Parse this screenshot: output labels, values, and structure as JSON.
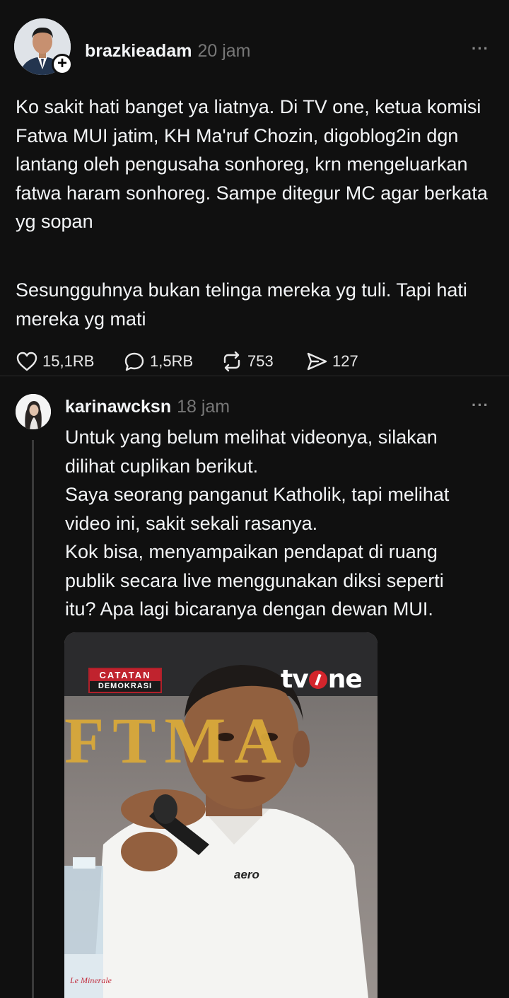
{
  "post": {
    "username": "brazkieadam",
    "time": "20 jam",
    "more_label": "···",
    "paragraphs": [
      "Ko sakit hati banget ya liatnya. Di TV one, ketua komisi Fatwa MUI jatim, KH Ma'ruf Chozin, digoblog2in dgn lantang oleh pengusaha sonhoreg, krn mengeluarkan fatwa haram sonhoreg. Sampe ditegur MC agar berkata yg sopan",
      "Sesungguhnya bukan telinga mereka yg tuli. Tapi hati mereka yg mati"
    ],
    "actions": {
      "likes": "15,1RB",
      "replies": "1,5RB",
      "reposts": "753",
      "shares": "127"
    },
    "icons": [
      "heart-icon",
      "comment-icon",
      "repost-icon",
      "share-icon"
    ]
  },
  "reply": {
    "username": "karinawcksn",
    "time": "18 jam",
    "more_label": "···",
    "text_lines": [
      "Untuk yang belum melihat videonya, silakan",
      "dilihat cuplikan berikut.",
      "Saya seorang panganut Katholik, tapi melihat",
      "video ini, sakit sekali rasanya.",
      "Kok bisa, menyampaikan pendapat di ruang",
      "publik secara live menggunakan diksi seperti",
      "itu? Apa lagi bicaranya dengan dewan MUI."
    ],
    "media": {
      "show_top": "CATATAN",
      "show_bottom": "DEMOKRASI",
      "channel_left": "tv",
      "channel_right": "ne",
      "backdrop_text": "FTMA",
      "shirt_logo": "aero",
      "bottle_text": "Le Minerale"
    }
  },
  "colors": {
    "background": "#101010",
    "text": "#f3f5f7",
    "muted": "#777777",
    "brand_red": "#d3252c"
  }
}
